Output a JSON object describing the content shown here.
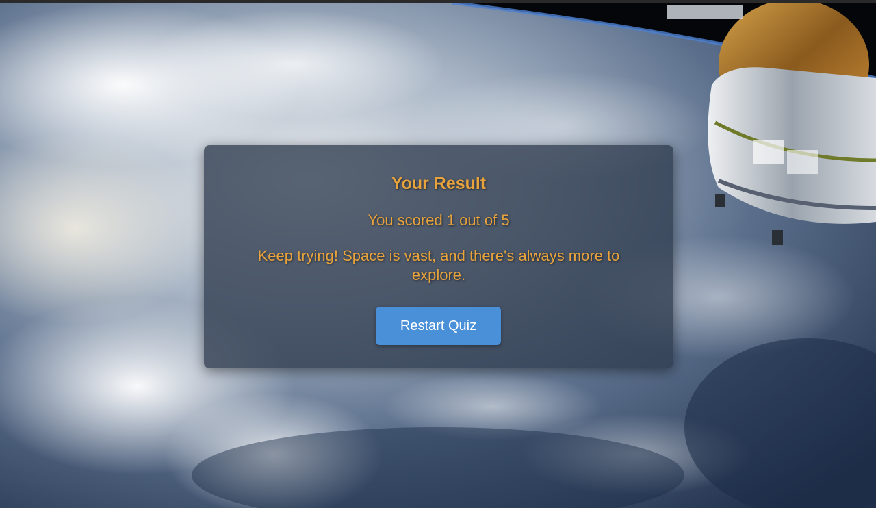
{
  "result": {
    "title": "Your Result",
    "score_text": "You scored 1 out of 5",
    "score": 1,
    "total": 5,
    "message": "Keep trying! Space is vast, and there's always more to explore.",
    "restart_label": "Restart Quiz"
  },
  "colors": {
    "accent_text": "#e8a33d",
    "button": "#4a90d9",
    "card": "#303c50"
  }
}
